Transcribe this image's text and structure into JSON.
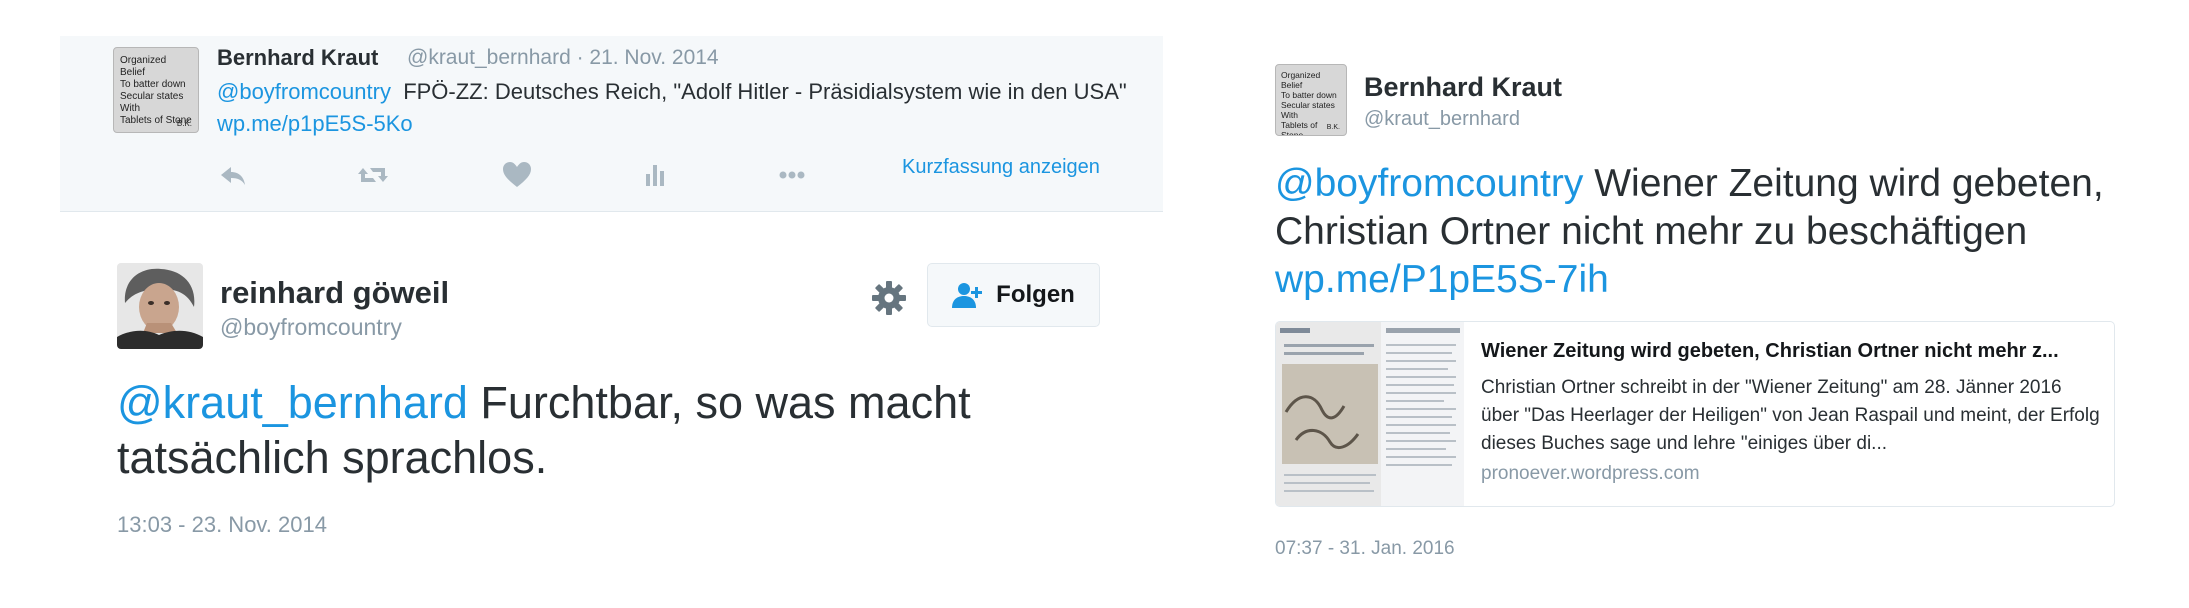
{
  "parent_tweet": {
    "avatar_badge": {
      "line1": "Organized Belief",
      "line2": "To batter down",
      "line3": "Secular states",
      "line4": "With",
      "line5": "Tablets of Stone",
      "initials": "B.K."
    },
    "author_name": "Bernhard Kraut",
    "meta": "@kraut_bernhard · 21. Nov. 2014",
    "mention": "@boyfromcountry",
    "text": "FPÖ-ZZ: Deutsches Reich, \"Adolf Hitler - Präsidialsystem wie in den USA\"",
    "link": "wp.me/p1pE5S-5Ko",
    "collapse_label": "Kurzfassung anzeigen",
    "icons": [
      "reply-icon",
      "retweet-icon",
      "like-icon",
      "stats-icon",
      "more-icon"
    ],
    "icon_color": "#aab8c2"
  },
  "reply_tweet": {
    "author_name": "reinhard göweil",
    "handle": "@boyfromcountry",
    "follow_label": "Folgen",
    "mention": "@kraut_bernhard",
    "text": "Furchtbar, so was macht tatsächlich sprachlos.",
    "timestamp": "13:03 - 23. Nov. 2014",
    "icons": [
      "gear-icon",
      "follow-user-icon"
    ]
  },
  "right_tweet": {
    "avatar_badge": {
      "line1": "Organized Belief",
      "line2": "To batter down",
      "line3": "Secular states",
      "line4": "With",
      "line5": "Tablets of Stone",
      "initials": "B.K."
    },
    "author_name": "Bernhard Kraut",
    "handle": "@kraut_bernhard",
    "mention": "@boyfromcountry",
    "text": "Wiener Zeitung wird gebeten, Christian Ortner nicht mehr zu beschäftigen",
    "link": "wp.me/P1pE5S-7ih",
    "card": {
      "title": "Wiener Zeitung wird gebeten, Christian Ortner nicht mehr z...",
      "description": "Christian Ortner schreibt in der \"Wiener Zeitung\"  am 28. Jänner 2016 über \"Das Heerlager der Heiligen\" von Jean Raspail und meint, der Erfolg dieses Buches sage und lehre \"einiges über di...",
      "domain": "pronoever.wordpress.com"
    },
    "timestamp": "07:37 - 31. Jan. 2016"
  },
  "colors": {
    "link": "#1b95e0",
    "text": "#292f33",
    "muted": "#8899a6",
    "parent_bg": "#f5f8fa",
    "border": "#e1e8ed"
  }
}
